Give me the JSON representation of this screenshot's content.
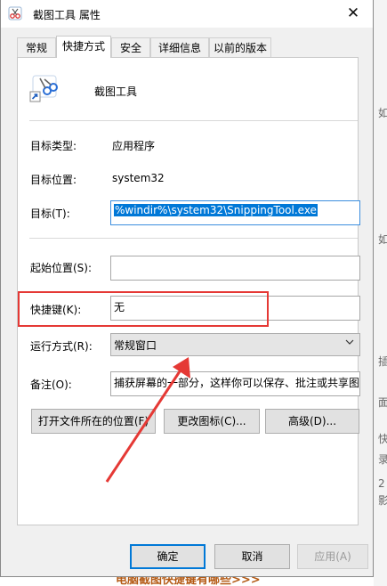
{
  "window": {
    "title": "截图工具 属性",
    "close_glyph": "✕"
  },
  "tabs": [
    {
      "label": "常规"
    },
    {
      "label": "快捷方式"
    },
    {
      "label": "安全"
    },
    {
      "label": "详细信息"
    },
    {
      "label": "以前的版本"
    }
  ],
  "shortcut": {
    "app_name": "截图工具",
    "target_type_label": "目标类型:",
    "target_type_value": "应用程序",
    "target_location_label": "目标位置:",
    "target_location_value": "system32",
    "target_label": "目标(T):",
    "target_value": "%windir%\\system32\\SnippingTool.exe",
    "start_in_label": "起始位置(S):",
    "start_in_value": "",
    "hotkey_label": "快捷键(K):",
    "hotkey_value": "无",
    "run_label": "运行方式(R):",
    "run_value": "常规窗口",
    "comment_label": "备注(O):",
    "comment_value": "捕获屏幕的一部分，这样你可以保存、批注或共享图"
  },
  "buttons": {
    "open_location": "打开文件所在的位置(F)",
    "change_icon": "更改图标(C)...",
    "advanced": "高级(D)...",
    "ok": "确定",
    "cancel": "取消",
    "apply": "应用(A)"
  },
  "background_text": {
    "right_glyphs": [
      "如",
      "如",
      "插",
      "面",
      "快",
      "录",
      "2",
      "影"
    ],
    "bottom_heading": "电脑截图快捷键有哪些>>>"
  },
  "colors": {
    "accent": "#0078d7",
    "annotation_red": "#e53935"
  }
}
